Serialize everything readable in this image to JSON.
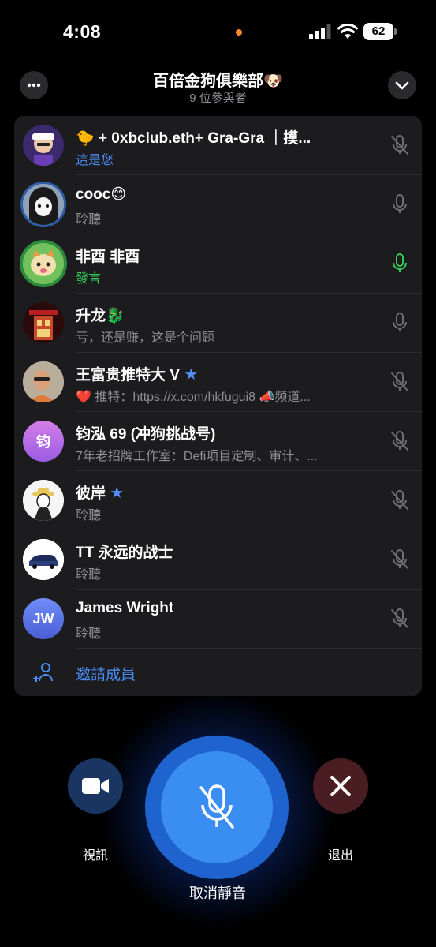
{
  "status_bar": {
    "time": "4:08",
    "battery": "62"
  },
  "header": {
    "title": "百倍金狗俱樂部🐶",
    "subtitle": "9 位參與者"
  },
  "participants": [
    {
      "name": "🐤 + 0xbclub.eth+ Gra-Gra ｜摸...",
      "status": "這是您",
      "status_color": "#4c8cf5",
      "mic": "muted"
    },
    {
      "name": "cooc😊",
      "status": "聆聽",
      "status_color": "#8e8e93",
      "mic": "idle"
    },
    {
      "name": "非酉 非酉",
      "status": "發言",
      "status_color": "#34c759",
      "mic": "speaking"
    },
    {
      "name": "升龙🐉",
      "status": "亏，还是赚，这是个问题",
      "status_color": "#8e8e93",
      "mic": "idle"
    },
    {
      "name": "王富贵推特大 V",
      "status": "❤️ 推特：https://x.com/hkfugui8 📣频道...",
      "status_color": "#8e8e93",
      "mic": "muted"
    },
    {
      "name": "钧泓 69 (冲狗挑战号)",
      "status": "7年老招牌工作室：Defi项目定制、审计、...",
      "status_color": "#8e8e93",
      "mic": "muted",
      "initials": "钧"
    },
    {
      "name": "彼岸",
      "status": "聆聽",
      "status_color": "#8e8e93",
      "mic": "muted"
    },
    {
      "name": "TT 永远的战士",
      "status": "聆聽",
      "status_color": "#8e8e93",
      "mic": "muted"
    },
    {
      "name": "James Wright",
      "status": "聆聽",
      "status_color": "#8e8e93",
      "mic": "muted",
      "initials": "JW"
    }
  ],
  "invite": {
    "label": "邀請成員"
  },
  "controls": {
    "video_label": "視訊",
    "unmute_label": "取消靜音",
    "leave_label": "退出"
  },
  "colors": {
    "accent": "#4c8cf5",
    "speaking": "#34c759",
    "unmute": "#3a8ef2",
    "leave": "#4a1d22"
  }
}
